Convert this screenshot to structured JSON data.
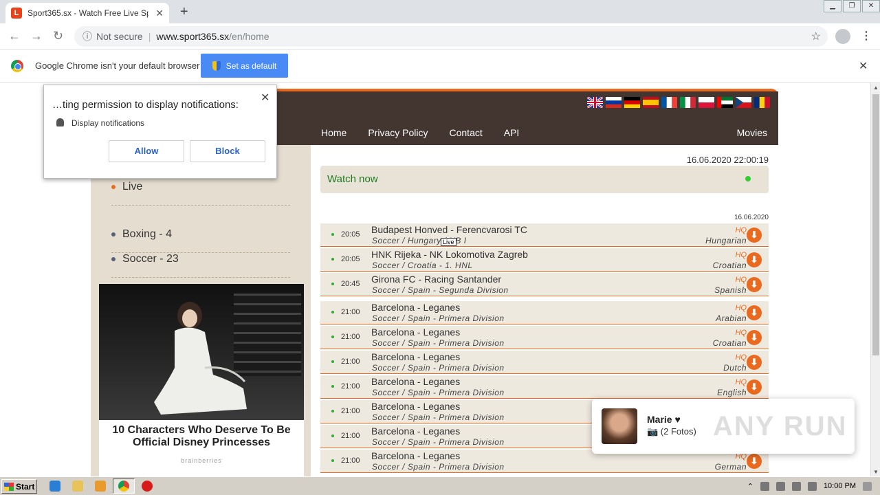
{
  "browser": {
    "tab_title": "Sport365.sx - Watch Free Live Sport",
    "tab_favicon_letter": "L",
    "not_secure": "Not secure",
    "url_host": "www.sport365.sx",
    "url_path": "/en/home",
    "infobar_message": "Google Chrome isn't your default browser",
    "set_default_label": "Set as default"
  },
  "permission_popup": {
    "question": "…ting permission to display notifications:",
    "item": "Display notifications",
    "allow": "Allow",
    "block": "Block"
  },
  "site": {
    "nav": [
      "Home",
      "Privacy Policy",
      "Contact",
      "API"
    ],
    "nav_movies": "Movies",
    "flags": [
      "gb",
      "ru",
      "de",
      "es",
      "fr",
      "it",
      "pl",
      "ae",
      "cz",
      "ro"
    ],
    "datetime": "16.06.2020  22:00:19",
    "watch_now": "Watch now",
    "day_date": "16.06.2020",
    "live_tooltip": "Live",
    "sidebar": [
      {
        "label": "Live",
        "dot_color": "#e96a1f"
      },
      {
        "label": "Boxing - 4",
        "dot_color": "#55607a"
      },
      {
        "label": "Soccer - 23",
        "dot_color": "#55607a"
      }
    ],
    "ad": {
      "title": "10 Characters Who Deserve To Be Official Disney Princesses",
      "source": "brainberries"
    },
    "events": [
      {
        "time": "20:05",
        "match": "Budapest Honved - Ferencvarosi TC",
        "league": "Soccer / Hungary / NB I",
        "quality": "HQ",
        "lang": "Hungarian"
      },
      {
        "time": "20:05",
        "match": "HNK Rijeka - NK Lokomotiva Zagreb",
        "league": "Soccer / Croatia - 1. HNL",
        "quality": "HQ",
        "lang": "Croatian"
      },
      {
        "time": "20:45",
        "match": "Girona FC - Racing Santander",
        "league": "Soccer / Spain - Segunda Division",
        "quality": "HQ",
        "lang": "Spanish"
      },
      {
        "time": "21:00",
        "match": "Barcelona - Leganes",
        "league": "Soccer / Spain - Primera Division",
        "quality": "HQ",
        "lang": "Arabian"
      },
      {
        "time": "21:00",
        "match": "Barcelona - Leganes",
        "league": "Soccer / Spain - Primera Division",
        "quality": "HQ",
        "lang": "Croatian"
      },
      {
        "time": "21:00",
        "match": "Barcelona - Leganes",
        "league": "Soccer / Spain - Primera Division",
        "quality": "HQ",
        "lang": "Dutch"
      },
      {
        "time": "21:00",
        "match": "Barcelona - Leganes",
        "league": "Soccer / Spain - Primera Division",
        "quality": "HQ",
        "lang": "English"
      },
      {
        "time": "21:00",
        "match": "Barcelona - Leganes",
        "league": "Soccer / Spain - Primera Division",
        "quality": "HQ",
        "lang": ""
      },
      {
        "time": "21:00",
        "match": "Barcelona - Leganes",
        "league": "Soccer / Spain - Primera Division",
        "quality": "HQ",
        "lang": ""
      },
      {
        "time": "21:00",
        "match": "Barcelona - Leganes",
        "league": "Soccer / Spain - Primera Division",
        "quality": "HQ",
        "lang": "German"
      }
    ]
  },
  "toast": {
    "name": "Marie ♥",
    "fotos": "📷 (2 Fotos)",
    "watermark": "ANY RUN"
  },
  "taskbar": {
    "start": "Start",
    "clock": "10:00 PM"
  },
  "colors": {
    "accent_orange": "#e96a1f",
    "header_brown": "#433631",
    "page_beige": "#e4ddd0"
  }
}
